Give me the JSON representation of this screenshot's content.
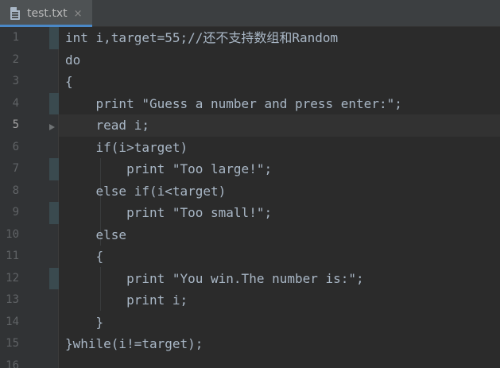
{
  "tab": {
    "label": "test.txt",
    "close_icon": "×",
    "icon": "text-file-icon"
  },
  "editor": {
    "current_line": 5,
    "lines": [
      {
        "number": "1",
        "text": "int i,target=55;//还不支持数组和Random",
        "marker": true
      },
      {
        "number": "2",
        "text": "do",
        "marker": false
      },
      {
        "number": "3",
        "text": "{",
        "marker": false
      },
      {
        "number": "4",
        "text": "    print \"Guess a number and press enter:\";",
        "marker": true
      },
      {
        "number": "5",
        "text": "    read i;",
        "marker": false
      },
      {
        "number": "6",
        "text": "    if(i>target)",
        "marker": false
      },
      {
        "number": "7",
        "text": "        print \"Too large!\";",
        "marker": true
      },
      {
        "number": "8",
        "text": "    else if(i<target)",
        "marker": false
      },
      {
        "number": "9",
        "text": "        print \"Too small!\";",
        "marker": true
      },
      {
        "number": "10",
        "text": "    else",
        "marker": false
      },
      {
        "number": "11",
        "text": "    {",
        "marker": false
      },
      {
        "number": "12",
        "text": "        print \"You win.The number is:\";",
        "marker": true
      },
      {
        "number": "13",
        "text": "        print i;",
        "marker": false
      },
      {
        "number": "14",
        "text": "    }",
        "marker": false
      },
      {
        "number": "15",
        "text": "}while(i!=target);",
        "marker": false
      },
      {
        "number": "16",
        "text": "",
        "marker": false
      }
    ]
  },
  "colors": {
    "background": "#2b2b2b",
    "gutter": "#313335",
    "text": "#a9b7c6",
    "line_number": "#606366",
    "current_line": "#323232",
    "tab_accent": "#4a88c7"
  }
}
